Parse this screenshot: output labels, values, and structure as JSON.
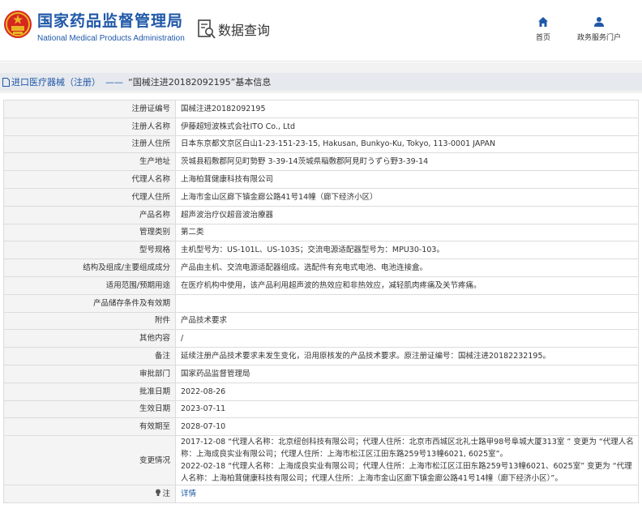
{
  "header": {
    "org_cn": "国家药品监督管理局",
    "org_en": "National Medical Products Administration",
    "query_label": "数据查询",
    "nav": [
      {
        "label": "首页",
        "icon": "home-icon"
      },
      {
        "label": "政务服务门户",
        "icon": "user-icon"
      }
    ]
  },
  "breadcrumb": {
    "section": "进口医疗器械（注册）",
    "separator": "——",
    "current": "“国械注进20182092195”基本信息"
  },
  "rows": [
    {
      "key": "注册证编号",
      "value": "国械注进20182092195"
    },
    {
      "key": "注册人名称",
      "value": "伊藤超短波株式会社ITO Co., Ltd"
    },
    {
      "key": "注册人住所",
      "value": "日本东京都文京区白山1-23-151-23-15, Hakusan, Bunkyo-Ku, Tokyo, 113-0001 JAPAN"
    },
    {
      "key": "生产地址",
      "value": "茨城县稻敷郡阿见町勢野 3-39-14茨城県稲敷郡阿見町うずら野3-39-14"
    },
    {
      "key": "代理人名称",
      "value": "上海柏茸健康科技有限公司"
    },
    {
      "key": "代理人住所",
      "value": "上海市金山区廊下镇金廊公路41号14幢（廊下经济小区）"
    },
    {
      "key": "产品名称",
      "value": "超声波治疗仪超音波治療器"
    },
    {
      "key": "管理类别",
      "value": "第二类"
    },
    {
      "key": "型号规格",
      "value": "主机型号为：US-101L、US-103S；交流电源适配器型号为：MPU30-103。"
    },
    {
      "key": "结构及组成/主要组成成分",
      "value": "产品由主机、交流电源适配器组成。选配件有充电式电池、电池连接盒。"
    },
    {
      "key": "适用范围/预期用途",
      "value": "在医疗机构中使用，该产品利用超声波的热效应和非热效应，减轻肌肉疼痛及关节疼痛。"
    },
    {
      "key": "产品储存条件及有效期",
      "value": ""
    },
    {
      "key": "附件",
      "value": "产品技术要求"
    },
    {
      "key": "其他内容",
      "value": "/"
    },
    {
      "key": "备注",
      "value": "延续注册产品技术要求未发生变化，沿用原核发的产品技术要求。原注册证编号：国械注进20182232195。"
    },
    {
      "key": "审批部门",
      "value": "国家药品监督管理局"
    },
    {
      "key": "批准日期",
      "value": "2022-08-26"
    },
    {
      "key": "生效日期",
      "value": "2023-07-11"
    },
    {
      "key": "有效期至",
      "value": "2028-07-10"
    }
  ],
  "changes": {
    "key": "变更情况",
    "lines": [
      "2017-12-08 “代理人名称：北京纽创科技有限公司；代理人住所：北京市西城区北礼士路甲98号阜城大厦313室 ” 变更为 “代理人名称：上海成良实业有限公司；代理人住所：上海市松江区江田东路259号13幢6021, 6025室”。",
      "2022-02-18 “代理人名称：上海成良实业有限公司；代理人住所：上海市松江区江田东路259号13幢6021、6025室” 变更为 “代理人名称：上海柏茸健康科技有限公司；代理人住所：上海市金山区廊下镇金廊公路41号14幢（廊下经济小区）”。"
    ]
  },
  "note": {
    "key": "注",
    "icon": "bulb-icon",
    "link": "详情"
  },
  "colors": {
    "brand_blue": "#1f58a8",
    "logo_red": "#d7261f",
    "logo_gold": "#e9b424"
  }
}
